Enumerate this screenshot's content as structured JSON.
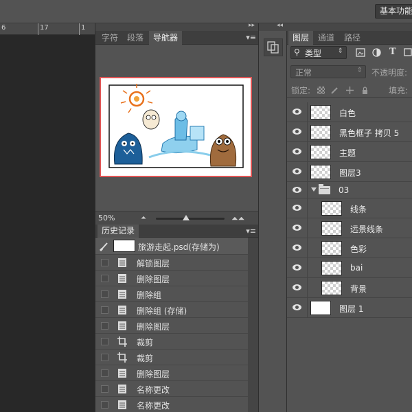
{
  "topbar": {
    "workspace_label": "基本功能"
  },
  "ruler": {
    "labels": [
      "6",
      "17",
      "1"
    ]
  },
  "navigator": {
    "tabs": [
      {
        "label": "字符",
        "active": false
      },
      {
        "label": "段落",
        "active": false
      },
      {
        "label": "导航器",
        "active": true
      }
    ],
    "zoom": "50%",
    "zoom_slider": 0.45
  },
  "history": {
    "tab_label": "历史记录",
    "snapshot": "旅游走起.psd(存储为)",
    "items": [
      {
        "label": "解锁图层",
        "icon": "document-icon"
      },
      {
        "label": "删除图层",
        "icon": "document-icon"
      },
      {
        "label": "删除组",
        "icon": "document-icon"
      },
      {
        "label": "删除组 (存储)",
        "icon": "document-icon"
      },
      {
        "label": "删除图层",
        "icon": "document-icon"
      },
      {
        "label": "裁剪",
        "icon": "crop-icon"
      },
      {
        "label": "裁剪",
        "icon": "crop-icon"
      },
      {
        "label": "删除图层",
        "icon": "document-icon"
      },
      {
        "label": "名称更改",
        "icon": "document-icon"
      },
      {
        "label": "名称更改",
        "icon": "document-icon"
      }
    ]
  },
  "layers_panel": {
    "tabs": [
      {
        "label": "图层",
        "active": true
      },
      {
        "label": "通道",
        "active": false
      },
      {
        "label": "路径",
        "active": false
      }
    ],
    "filter_label": "类型",
    "blend_mode": "正常",
    "opacity_label": "不透明度:",
    "lock_label": "锁定:",
    "fill_label": "填充:",
    "layers": [
      {
        "name": "白色",
        "indent": 0
      },
      {
        "name": "黑色框子 拷贝 5",
        "indent": 0
      },
      {
        "name": "主题",
        "indent": 0
      },
      {
        "name": "图层3",
        "indent": 0
      },
      {
        "name": "03",
        "indent": 0,
        "group": true
      },
      {
        "name": "线条",
        "indent": 1
      },
      {
        "name": "远景线条",
        "indent": 1
      },
      {
        "name": "色彩",
        "indent": 1
      },
      {
        "name": "bai",
        "indent": 1
      },
      {
        "name": "背景",
        "indent": 1
      },
      {
        "name": "图层 1",
        "indent": 0,
        "white": true
      }
    ]
  }
}
